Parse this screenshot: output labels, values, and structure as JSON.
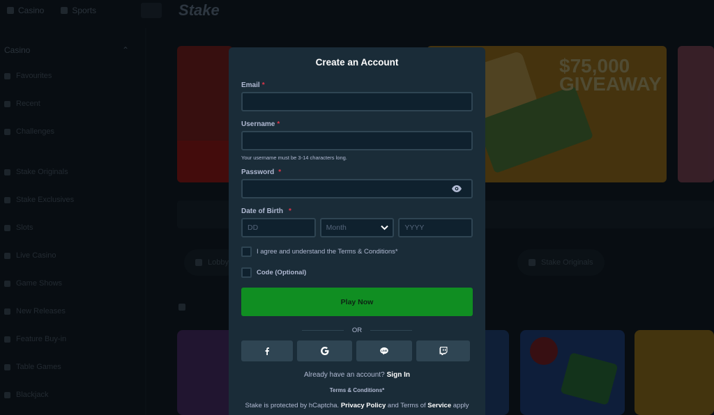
{
  "background": {
    "topbar": {
      "tabs": [
        "Casino",
        "Sports"
      ]
    },
    "sidebar": {
      "header": "Casino",
      "items": [
        "Favourites",
        "Recent",
        "Challenges",
        "Stake Originals",
        "Stake Exclusives",
        "Slots",
        "Live Casino",
        "Game Shows",
        "New Releases",
        "Feature Buy-in",
        "Table Games",
        "Blackjack"
      ]
    },
    "banner_text": [
      "$75,000",
      "GIVEAWAY"
    ],
    "pills": [
      "Lobby",
      "Stake Originals"
    ]
  },
  "modal": {
    "title": "Create an Account",
    "email_label": "Email",
    "username_label": "Username",
    "username_hint": "Your username must be 3-14 characters long.",
    "password_label": "Password",
    "dob_label": "Date of Birth",
    "required_marker": "*",
    "dob": {
      "day_placeholder": "DD",
      "month_value": "Month",
      "year_placeholder": "YYYY"
    },
    "terms_checkbox_label": "I agree and understand the Terms & Conditions*",
    "code_checkbox_label": "Code (Optional)",
    "play_button": "Play Now",
    "or_text": "OR",
    "social_buttons": [
      {
        "icon": "facebook-icon"
      },
      {
        "icon": "google-icon"
      },
      {
        "icon": "line-icon"
      },
      {
        "icon": "twitch-icon"
      }
    ],
    "signin_prompt": "Already have an account?",
    "signin_link": "Sign In",
    "terms_link": "Terms & Conditions*",
    "captcha_prefix": "Stake is protected by hCaptcha.",
    "privacy_link": "Privacy Policy",
    "captcha_and": "and Terms of",
    "service_link": "Service",
    "captcha_suffix": "apply"
  },
  "colors": {
    "modal_bg": "#1a2c38",
    "input_bg": "#0f212e",
    "input_border": "#2f4553",
    "accent_green": "#108e22",
    "required_red": "#e0364a"
  }
}
